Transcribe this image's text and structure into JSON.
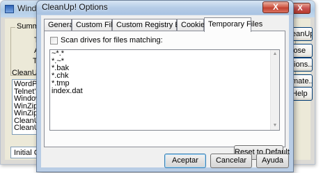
{
  "background_window": {
    "title": "Windo",
    "close_label": "X",
    "summary_label": "Summa",
    "summary_letters": [
      "T",
      "A",
      "Ta"
    ],
    "list_label": "CleanUp",
    "list_items": [
      "WordPa",
      "Telnet's",
      "Window",
      "WinZip",
      "WinZip",
      "CleanUp",
      "CleanUp"
    ],
    "status_text": "Initial Cle",
    "buttons": [
      "eanUp!",
      "lose",
      "tions...",
      "mate...",
      "Help"
    ]
  },
  "dialog": {
    "title": "CleanUp! Options",
    "close_label": "X",
    "tabs": [
      {
        "label": "General"
      },
      {
        "label": "Custom Files"
      },
      {
        "label": "Custom Registry Entries"
      },
      {
        "label": "Cookies"
      },
      {
        "label": "Temporary Files",
        "active": true
      }
    ],
    "scan_label": "Scan drives for files matching:",
    "scan_checked": false,
    "patterns": [
      "~*.*",
      "*.~*",
      "*.bak",
      "*.chk",
      "*.tmp",
      "index.dat"
    ],
    "reset_button": "Reset to Default",
    "accept_button": "Aceptar",
    "cancel_button": "Cancelar",
    "help_button": "Ayuda"
  }
}
